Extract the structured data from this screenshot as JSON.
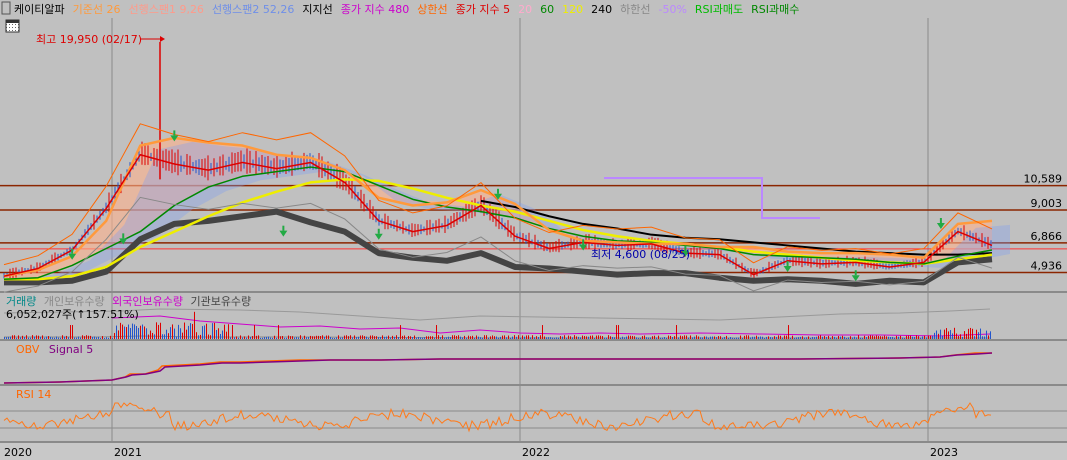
{
  "legend": {
    "items": [
      {
        "text": "케이티알파",
        "color": "#000000"
      },
      {
        "text": "기준선 26",
        "color": "#ff9a3c"
      },
      {
        "text": "선행스팬1 9,26",
        "color": "#ff9a8a"
      },
      {
        "text": "선행스팬2 52,26",
        "color": "#6f8fe8"
      },
      {
        "text": "지지선",
        "color": "#000000"
      },
      {
        "text": "종가 지수 480",
        "color": "#cc00cc"
      },
      {
        "text": "상한선",
        "color": "#ff6600"
      },
      {
        "text": "종가 지수 5",
        "color": "#dd0000"
      },
      {
        "text": "20",
        "color": "#ffaacc"
      },
      {
        "text": "60",
        "color": "#008800"
      },
      {
        "text": "120",
        "color": "#eeee00"
      },
      {
        "text": "240",
        "color": "#000000"
      },
      {
        "text": "하한선",
        "color": "#888888"
      },
      {
        "text": "-50%",
        "color": "#bb88ff"
      },
      {
        "text": "RSI과매도",
        "color": "#00bb00"
      },
      {
        "text": "RSI과매수",
        "color": "#008800"
      }
    ]
  },
  "price_panel": {
    "high_label": "최고 19,950 (02/17)",
    "low_label": "최저 4,600 (08/25)",
    "levels": [
      {
        "label": "10,589",
        "value": 10589
      },
      {
        "label": "9,003",
        "value": 9003
      },
      {
        "label": "6,866",
        "value": 6866
      },
      {
        "label": "4,936",
        "value": 4936
      }
    ]
  },
  "volume_panel": {
    "legend": [
      {
        "text": "거래량",
        "color": "#008888"
      },
      {
        "text": "개인보유수량",
        "color": "#888888"
      },
      {
        "text": "외국인보유수량",
        "color": "#cc00cc"
      },
      {
        "text": "기관보유수량",
        "color": "#444444"
      }
    ],
    "readout": "6,052,027주(↑157.51%)"
  },
  "obv_panel": {
    "legend": [
      {
        "text": "OBV",
        "color": "#ff6600"
      },
      {
        "text": "Signal 5",
        "color": "#800080"
      }
    ]
  },
  "rsi_panel": {
    "legend": [
      {
        "text": "RSI 14",
        "color": "#ff6600"
      }
    ]
  },
  "x_axis": {
    "ticks": [
      "2020",
      "2021",
      "2022",
      "2023"
    ]
  },
  "chart_data": {
    "type": "line",
    "x": [
      "2020-10",
      "2020-11",
      "2020-12",
      "2021-01",
      "2021-02",
      "2021-03",
      "2021-04",
      "2021-05",
      "2021-06",
      "2021-07",
      "2021-08",
      "2021-09",
      "2021-10",
      "2021-11",
      "2021-12",
      "2022-01",
      "2022-02",
      "2022-03",
      "2022-04",
      "2022-05",
      "2022-06",
      "2022-07",
      "2022-08",
      "2022-09",
      "2022-10",
      "2022-11",
      "2022-12",
      "2023-01",
      "2023-02",
      "2023-03"
    ],
    "series": [
      {
        "name": "케이티알파",
        "color": "#dd0000",
        "values": [
          4700,
          5200,
          6400,
          9100,
          12600,
          12000,
          11600,
          12100,
          11700,
          12100,
          10800,
          8300,
          7600,
          8000,
          9300,
          7300,
          6500,
          6900,
          6700,
          6800,
          6200,
          6100,
          4800,
          5700,
          5500,
          5600,
          5300,
          5600,
          7600,
          6700
        ]
      },
      {
        "name": "기준선 26",
        "color": "#ff9a3c",
        "values": [
          4700,
          5100,
          6000,
          8300,
          13200,
          13700,
          13400,
          13200,
          12600,
          12400,
          11600,
          9800,
          9300,
          9500,
          10300,
          9400,
          7700,
          7000,
          6900,
          6800,
          6800,
          6600,
          6600,
          6300,
          6200,
          6200,
          6100,
          5900,
          8100,
          8300
        ]
      },
      {
        "name": "60",
        "color": "#008800",
        "values": [
          4500,
          4600,
          5400,
          6500,
          7600,
          9300,
          10500,
          11200,
          11500,
          11800,
          11500,
          10600,
          9700,
          9200,
          8900,
          8500,
          7800,
          7300,
          7000,
          6900,
          6700,
          6500,
          6100,
          6000,
          5900,
          5800,
          5600,
          5500,
          6000,
          6400
        ]
      },
      {
        "name": "120",
        "color": "#eeee00",
        "values": [
          4500,
          4500,
          4700,
          5300,
          6600,
          7600,
          8600,
          9500,
          10200,
          10800,
          11000,
          10900,
          10400,
          9800,
          9300,
          8900,
          8300,
          7700,
          7300,
          7000,
          6800,
          6600,
          6300,
          6100,
          5900,
          5700,
          5600,
          5500,
          5800,
          6100
        ]
      },
      {
        "name": "240",
        "color": "#000000",
        "values": [
          null,
          null,
          null,
          null,
          null,
          null,
          null,
          null,
          null,
          null,
          null,
          null,
          null,
          null,
          9600,
          9200,
          8600,
          8100,
          7800,
          7400,
          7200,
          7100,
          6900,
          6700,
          6500,
          6300,
          6200,
          6100,
          6100,
          6200
        ]
      },
      {
        "name": "지지선",
        "color": "#444444",
        "values": [
          4300,
          4300,
          4400,
          5000,
          7100,
          8100,
          8300,
          8600,
          8900,
          8200,
          7600,
          6200,
          5900,
          5700,
          6200,
          5300,
          5200,
          5000,
          4800,
          4900,
          4900,
          4600,
          4400,
          4500,
          4400,
          4200,
          4400,
          4300,
          5600,
          5800
        ]
      }
    ],
    "ylim": [
      3800,
      21500
    ],
    "grid": true
  }
}
